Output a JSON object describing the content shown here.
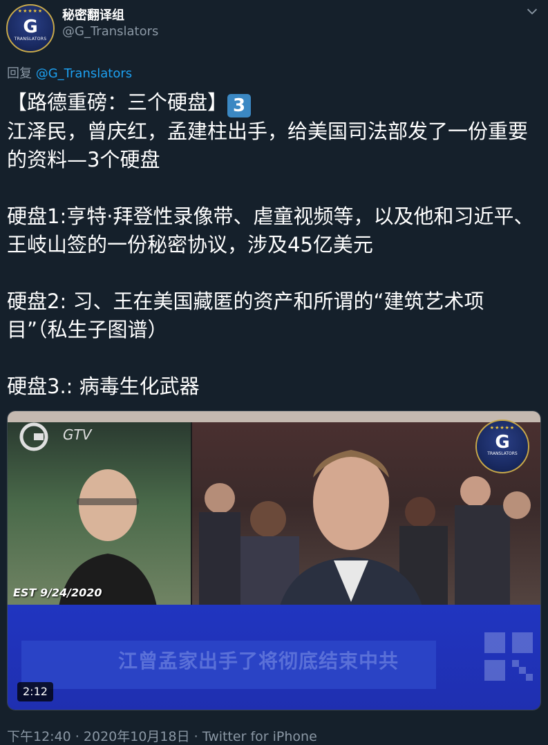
{
  "author": {
    "display_name": "秘密翻译组",
    "handle": "@G_Translators",
    "avatar_letter": "G",
    "avatar_caption": "TRANSLATORS"
  },
  "reply": {
    "prefix": "回复 ",
    "mention": "@G_Translators"
  },
  "tweet": {
    "title": "【路德重磅：三个硬盘】",
    "keycap": "3",
    "lines": [
      "江泽民，曾庆红，孟建柱出手，给美国司法部发了一份重要的资料—3个硬盘",
      "硬盘1:亨特·拜登性录像带、虐童视频等，以及他和习近平、王岐山签的一份秘密协议，涉及45亿美元",
      "硬盘2: 习、王在美国藏匿的资产和所谓的“建筑艺术项目”（私生子图谱）",
      "硬盘3.:  病毒生化武器"
    ]
  },
  "media": {
    "watermark": "GTV",
    "date_stamp": "EST 9/24/2020",
    "logo_letter": "G",
    "logo_caption": "TRANSLATORS",
    "banner_text": "江曾孟家出手了将彻底结束中共",
    "duration": "2:12"
  },
  "footer": {
    "time": "下午12:40",
    "date": "2020年10月18日",
    "separator": " · ",
    "source": "Twitter for iPhone"
  },
  "colors": {
    "background": "#15202b",
    "secondary_text": "#8b98a5",
    "link": "#1da1f2",
    "banner": "#2035c0"
  }
}
